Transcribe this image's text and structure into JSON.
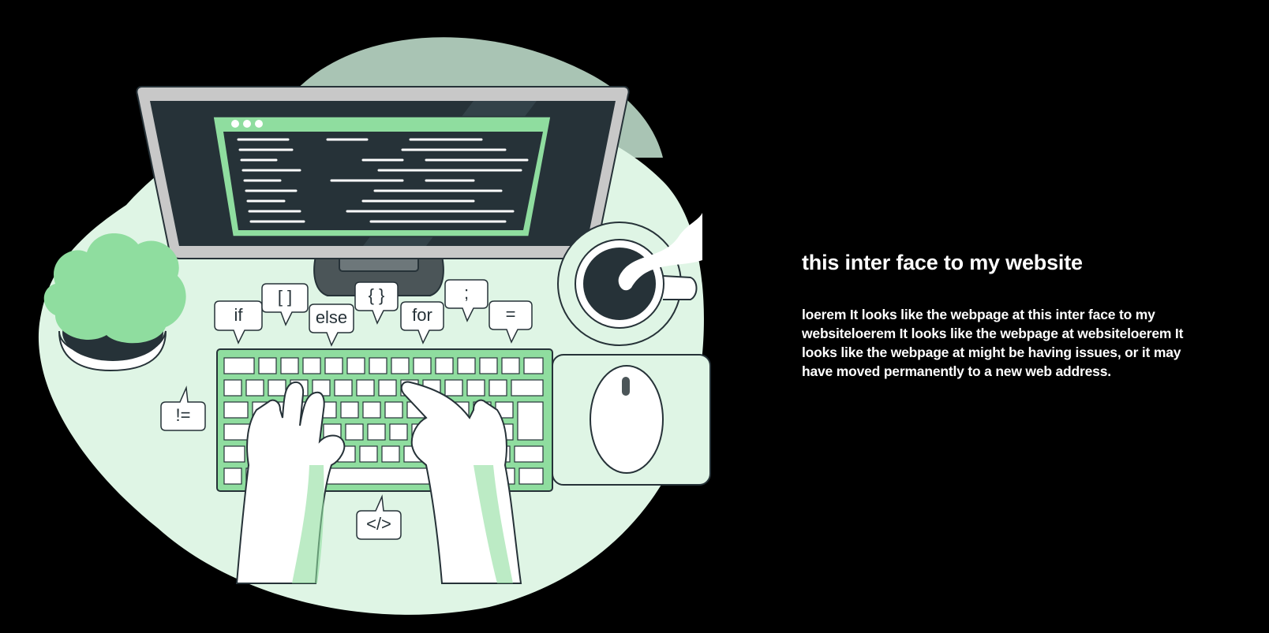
{
  "hero": {
    "title": "this inter face to my website",
    "description": "loerem It looks like the webpage at this inter face to my websiteloerem It looks like the webpage at websiteloerem It looks like the webpage at might be having issues, or it may have moved permanently to a new web address."
  },
  "illustration": {
    "code_bubbles": [
      "if",
      "[ ]",
      "else",
      "{ }",
      "for",
      ";",
      "=",
      "!=",
      "</>"
    ],
    "colors": {
      "accent": "#8fdd9f",
      "blob": "#dff5e5",
      "blob_back": "#a9c4b4",
      "outline": "#263238"
    }
  }
}
